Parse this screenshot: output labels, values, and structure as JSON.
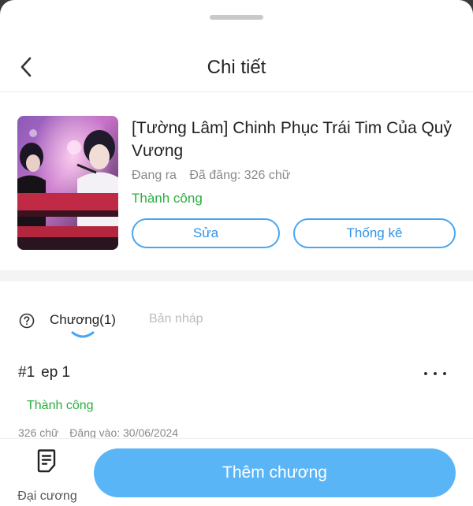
{
  "header": {
    "title": "Chi tiết"
  },
  "book": {
    "title": "[Tường Lâm] Chinh Phục Trái Tim Của Quỷ Vương",
    "status": "Đang ra",
    "word_count": "Đã đăng: 326 chữ",
    "review_state": "Thành công",
    "edit_label": "Sửa",
    "stats_label": "Thống kê"
  },
  "tabs": {
    "chapters_label": "Chương(1)",
    "drafts_label": "Bản nháp"
  },
  "chapter": {
    "number": "#1",
    "name": "ep 1",
    "state": "Thành công",
    "words": "326 chữ",
    "posted": "Đăng vào:  30/06/2024"
  },
  "bottom": {
    "outline_label": "Đại cương",
    "add_chapter_label": "Thêm chương"
  },
  "colors": {
    "accent": "#4aa6f1",
    "cta": "#5ab5f7",
    "success": "#2aae3f",
    "muted": "#8a8a8a"
  },
  "icons": [
    "chevron-left-icon",
    "help-circle-icon",
    "more-horizontal-icon",
    "outline-document-icon"
  ]
}
